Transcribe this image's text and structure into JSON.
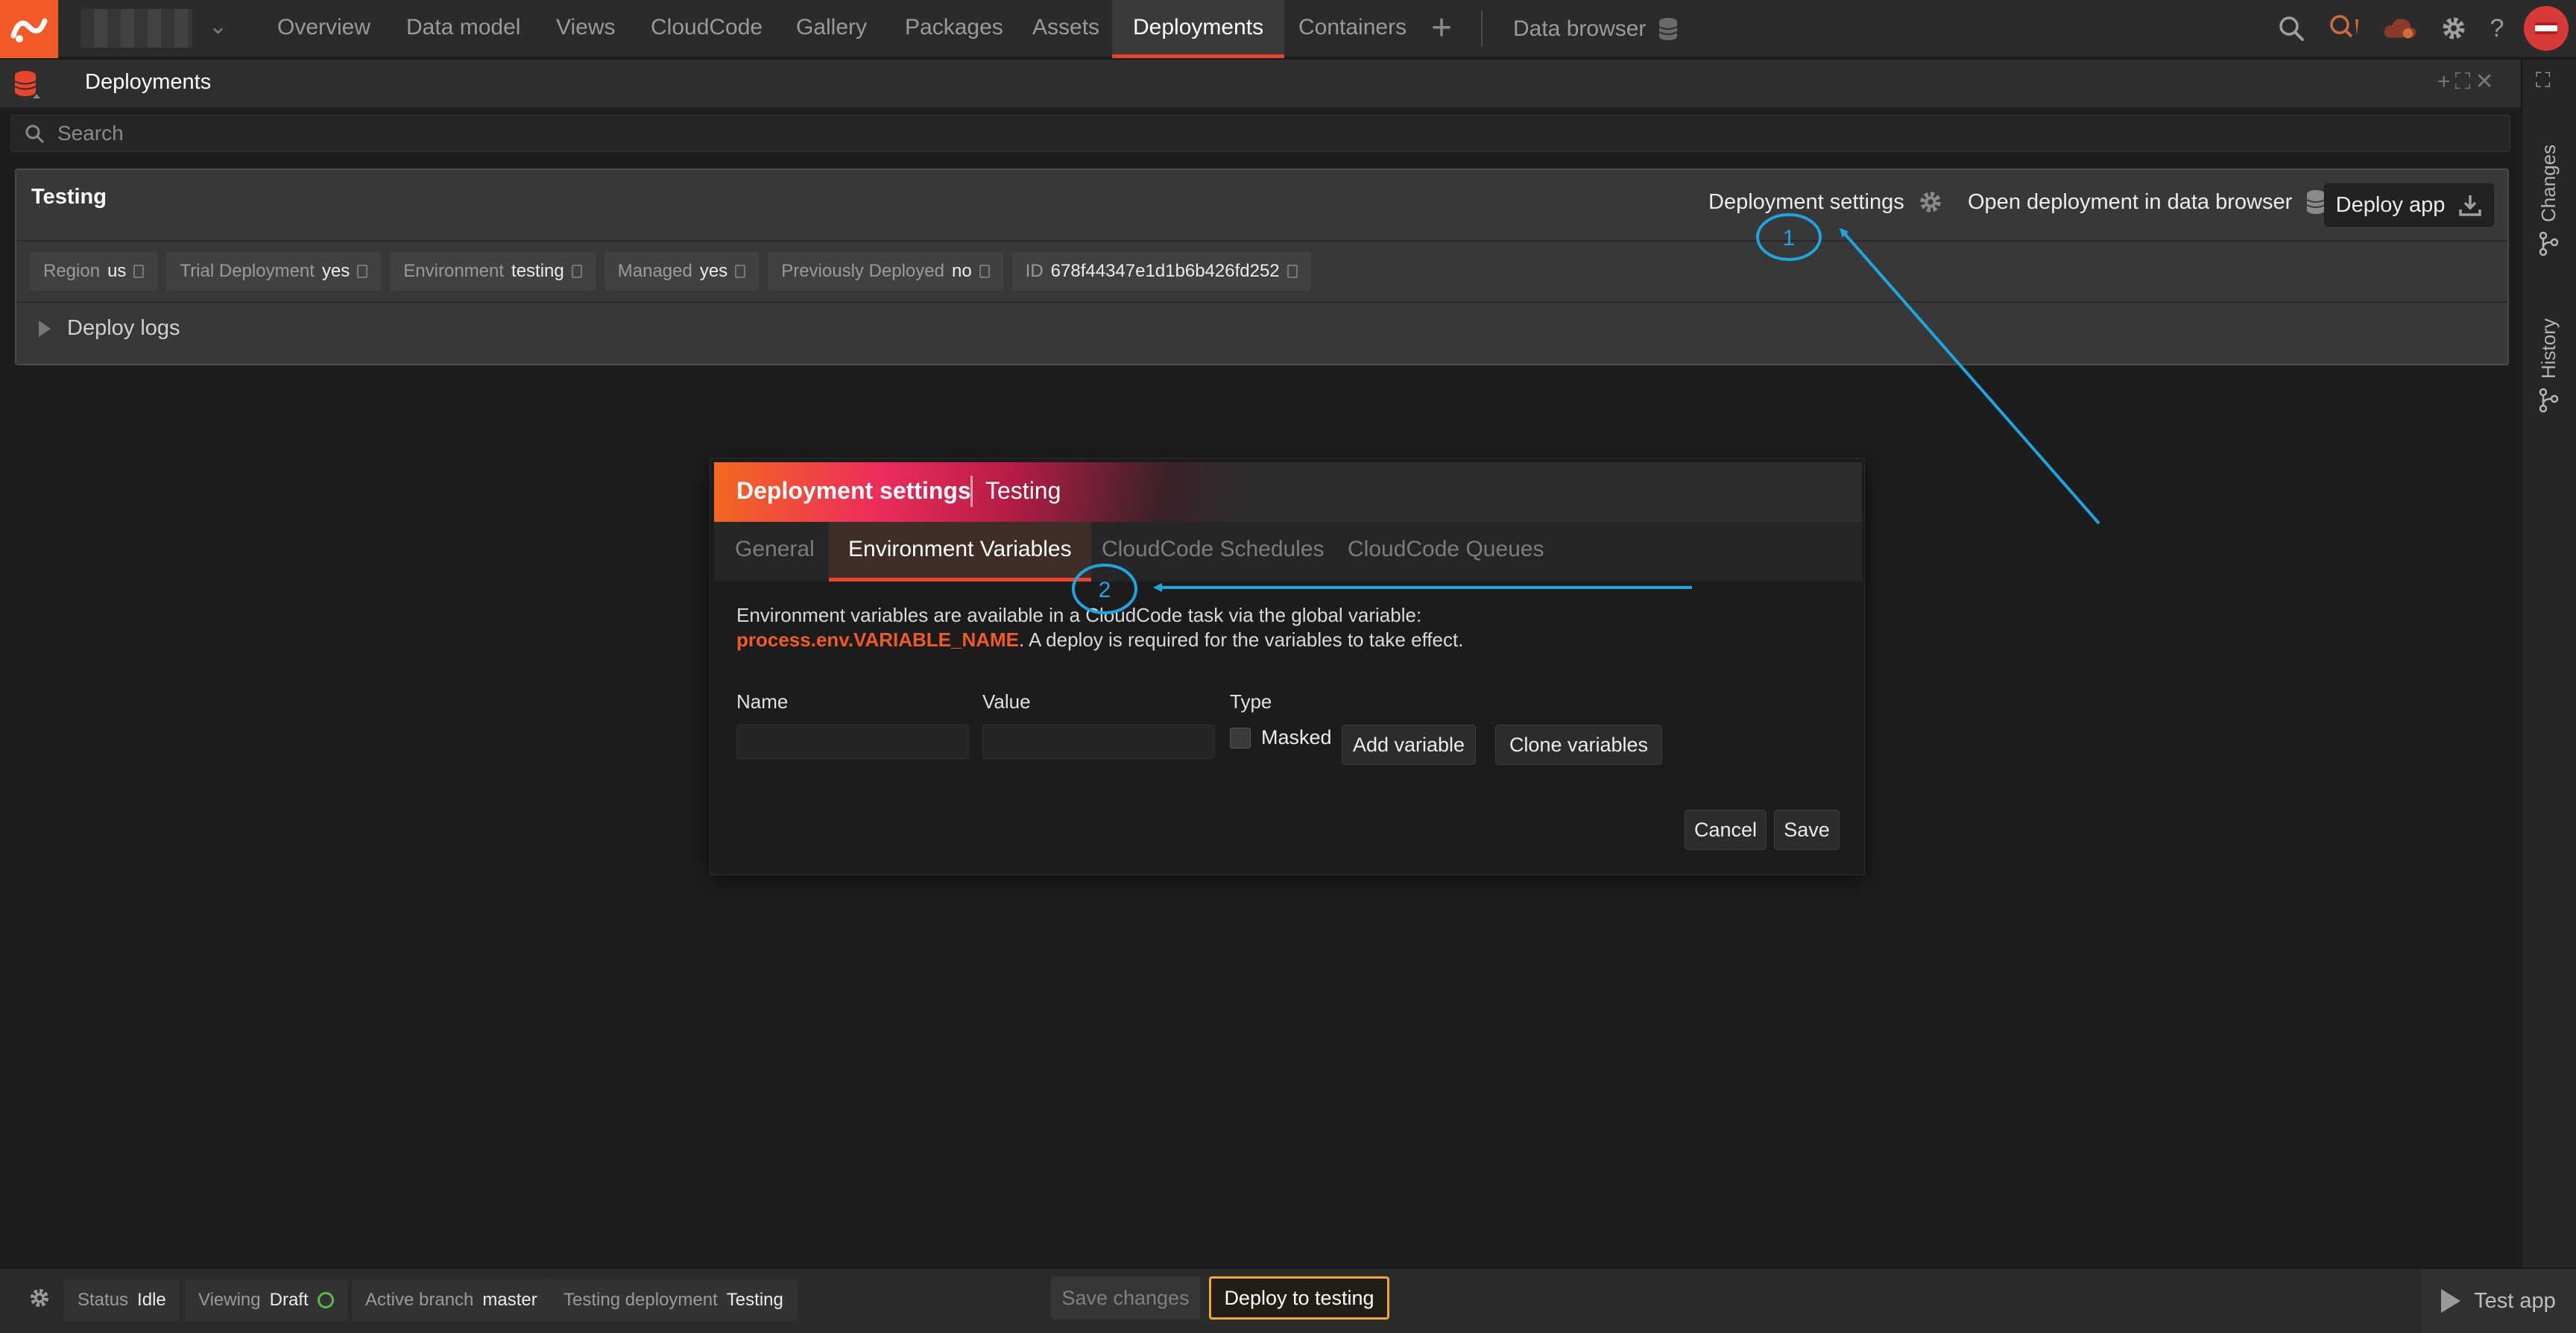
{
  "nav": {
    "tabs": [
      "Overview",
      "Data model",
      "Views",
      "CloudCode",
      "Gallery",
      "Packages",
      "Assets",
      "Deployments",
      "Containers"
    ],
    "data_browser": "Data browser"
  },
  "panel": {
    "title": "Deployments"
  },
  "search": {
    "placeholder": "Search"
  },
  "card": {
    "title": "Testing",
    "settings_label": "Deployment settings",
    "open_browser_label": "Open deployment in data browser",
    "deploy_app_label": "Deploy app",
    "meta": [
      {
        "key": "Region",
        "value": "us"
      },
      {
        "key": "Trial Deployment",
        "value": "yes"
      },
      {
        "key": "Environment",
        "value": "testing"
      },
      {
        "key": "Managed",
        "value": "yes"
      },
      {
        "key": "Previously Deployed",
        "value": "no"
      },
      {
        "key": "ID",
        "value": "678f44347e1d1b6b426fd252"
      }
    ],
    "deploy_logs": "Deploy logs"
  },
  "sidebar": {
    "changes": "Changes",
    "history": "History"
  },
  "modal": {
    "title": "Deployment settings",
    "subtitle": "Testing",
    "tabs": [
      "General",
      "Environment Variables",
      "CloudCode Schedules",
      "CloudCode Queues"
    ],
    "desc_line1": "Environment variables are available in a CloudCode task via the global variable:",
    "desc_code": "process.env.VARIABLE_NAME",
    "desc_line2_rest": ". A deploy is required for the variables to take effect.",
    "col_name": "Name",
    "col_value": "Value",
    "col_type": "Type",
    "name_value": "",
    "value_value": "",
    "masked_label": "Masked",
    "add_variable": "Add variable",
    "clone_variables": "Clone variables",
    "cancel": "Cancel",
    "save": "Save"
  },
  "annotations": {
    "marker1": "1",
    "marker2": "2"
  },
  "statusbar": {
    "status_key": "Status",
    "status_value": "Idle",
    "viewing_key": "Viewing",
    "viewing_value": "Draft",
    "branch_key": "Active branch",
    "branch_value": "master",
    "testing_key": "Testing deployment",
    "testing_value": "Testing",
    "save_changes": "Save changes",
    "deploy_to_testing": "Deploy to testing",
    "test_app": "Test app"
  },
  "colors": {
    "accent": "#f25a27",
    "active_tab_underline": "#e8452c",
    "annotation": "#1ea4de",
    "deploy_button_border": "#f0a92e"
  }
}
